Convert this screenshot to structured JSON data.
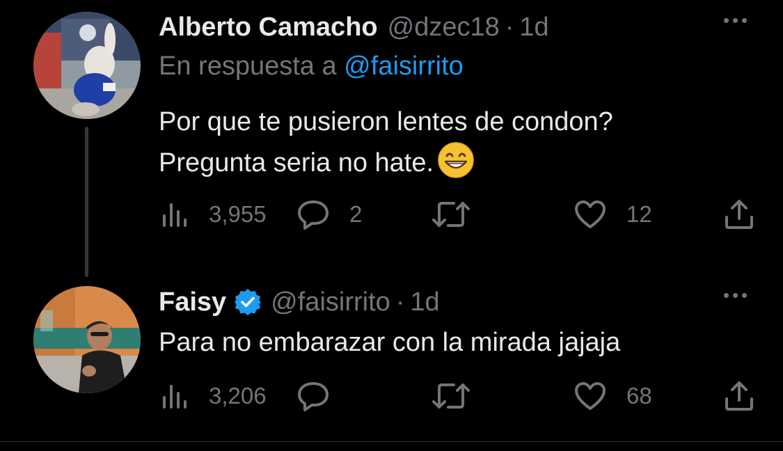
{
  "tweets": [
    {
      "display_name": "Alberto Camacho",
      "handle": "@dzec18",
      "separator": "·",
      "time": "1d",
      "reply_prefix": "En respuesta a",
      "reply_mention": "@faisirrito",
      "text_line_1": "Por que te pusieron lentes de condon?",
      "text_line_2": "Pregunta seria no hate.",
      "emoji": "grinning-face-with-smiling-eyes",
      "views": "3,955",
      "replies": "2",
      "retweets": "",
      "likes": "12",
      "verified": false
    },
    {
      "display_name": "Faisy",
      "handle": "@faisirrito",
      "separator": "·",
      "time": "1d",
      "text_line_1": "Para no embarazar con la mirada jajaja",
      "views": "3,206",
      "replies": "",
      "retweets": "",
      "likes": "68",
      "verified": true
    }
  ],
  "colors": {
    "background": "#000000",
    "primary_text": "#e7e9ea",
    "secondary_text": "#71767b",
    "mention": "#1d9bf0",
    "verified_badge": "#1d9bf0",
    "thread_line": "#333639"
  },
  "icons": [
    "views-icon",
    "reply-icon",
    "retweet-icon",
    "like-icon",
    "share-icon",
    "more-icon",
    "verified-badge-icon"
  ]
}
